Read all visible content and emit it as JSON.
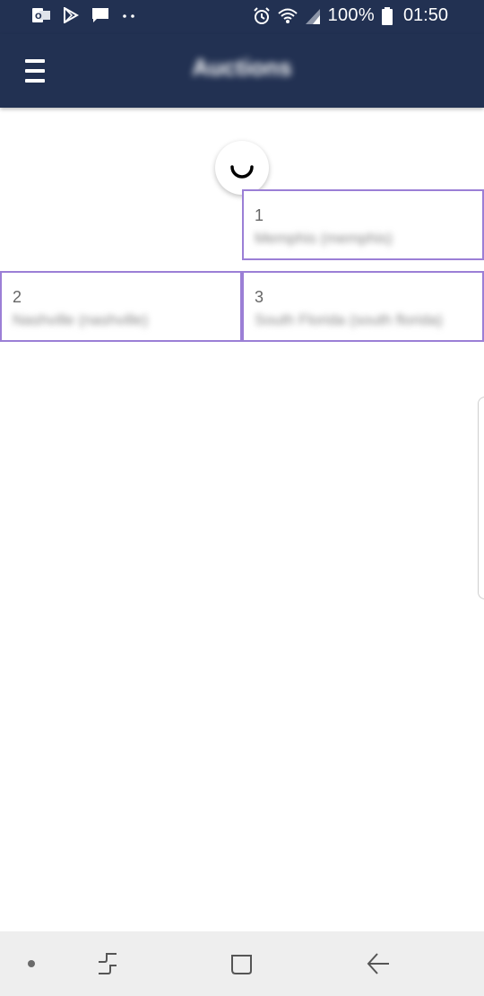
{
  "status_bar": {
    "left_icons": [
      "outlook-icon",
      "play-store-icon",
      "message-icon",
      "more-notifications-icon"
    ],
    "right_icons": [
      "alarm-icon",
      "wifi-icon",
      "signal-icon",
      "battery-icon"
    ],
    "battery": "100%",
    "time": "01:50"
  },
  "app_bar": {
    "title": "Auctions",
    "menu_icon": "hamburger-menu-icon"
  },
  "loading": {
    "icon": "loading-spinner-icon"
  },
  "auctions": [
    {
      "number": "1",
      "name": "Memphis (memphis)"
    },
    {
      "number": "2",
      "name": "Nashville (nashville)"
    },
    {
      "number": "3",
      "name": "South Florida (south florida)"
    }
  ],
  "navigation": {
    "items": [
      "dot-icon",
      "recents-icon",
      "home-icon",
      "back-icon"
    ]
  },
  "colors": {
    "primary": "#223152",
    "card_border": "#9b7fd6",
    "nav_background": "#eeeeee"
  }
}
